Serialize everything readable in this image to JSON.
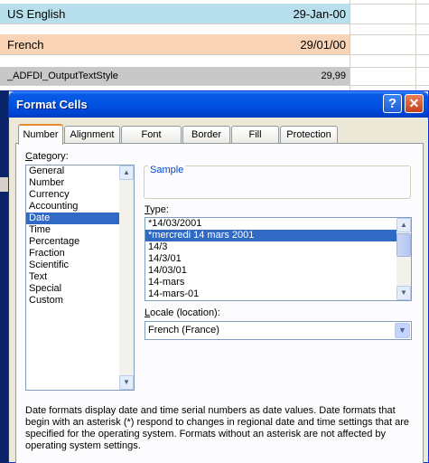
{
  "sheet": {
    "rows": [
      {
        "label": "US English",
        "value": "29-Jan-00"
      },
      {
        "label": "French",
        "value": "29/01/00"
      },
      {
        "label": "_ADFDI_OutputTextStyle",
        "value": "29,99"
      }
    ],
    "colors": {
      "us_fill": "#b8e0ec",
      "fr_fill": "#f9d3b6",
      "adfdi_fill": "#c8c8c8"
    }
  },
  "dialog": {
    "title": "Format Cells",
    "help_glyph": "?",
    "close_glyph": "✕",
    "tabs": [
      "Number",
      "Alignment",
      "Font",
      "Border",
      "Fill",
      "Protection"
    ],
    "active_tab": "Number",
    "category": {
      "label_prefix": "C",
      "label_rest": "ategory:",
      "items": [
        "General",
        "Number",
        "Currency",
        "Accounting",
        "Date",
        "Time",
        "Percentage",
        "Fraction",
        "Scientific",
        "Text",
        "Special",
        "Custom"
      ],
      "selected": "Date"
    },
    "sample": {
      "label": "Sample",
      "value": ""
    },
    "type": {
      "label_prefix": "T",
      "label_rest": "ype:",
      "items": [
        "*14/03/2001",
        "*mercredi 14 mars 2001",
        "14/3",
        "14/3/01",
        "14/03/01",
        "14-mars",
        "14-mars-01"
      ],
      "selected": "*mercredi 14 mars 2001"
    },
    "locale": {
      "label_prefix": "L",
      "label_rest": "ocale (location):",
      "value": "French (France)"
    },
    "description": "Date formats display date and time serial numbers as date values.  Date formats that begin with an asterisk (*) respond to changes in regional date and time settings that are specified for the operating system. Formats without an asterisk are not affected by operating system settings."
  },
  "icons": {
    "help": "help-icon",
    "close": "close-icon",
    "scroll_up": "scroll-up-icon",
    "scroll_down": "scroll-down-icon",
    "dropdown": "chevron-down-icon"
  }
}
